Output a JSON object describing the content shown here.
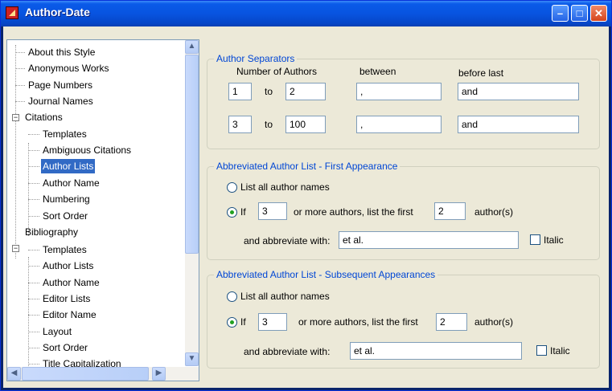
{
  "window": {
    "title": "Author-Date"
  },
  "tree": {
    "items": [
      {
        "label": "About this Style"
      },
      {
        "label": "Anonymous Works"
      },
      {
        "label": "Page Numbers"
      },
      {
        "label": "Journal Names"
      },
      {
        "label": "Citations",
        "expander": "−"
      },
      {
        "label": "Templates"
      },
      {
        "label": "Ambiguous Citations"
      },
      {
        "label": "Author Lists",
        "selected": true
      },
      {
        "label": "Author Name"
      },
      {
        "label": "Numbering"
      },
      {
        "label": "Sort Order"
      },
      {
        "label": "Bibliography",
        "expander": "−"
      },
      {
        "label": "Templates"
      },
      {
        "label": "Author Lists"
      },
      {
        "label": "Author Name"
      },
      {
        "label": "Editor Lists"
      },
      {
        "label": "Editor Name"
      },
      {
        "label": "Layout"
      },
      {
        "label": "Sort Order"
      },
      {
        "label": "Title Capitalization"
      }
    ]
  },
  "separators": {
    "legend": "Author Separators",
    "col_number": "Number of Authors",
    "col_between": "between",
    "col_before_last": "before last",
    "to_label": "to",
    "rows": [
      {
        "from": "1",
        "to": "2",
        "between": ",",
        "before_last": "and"
      },
      {
        "from": "3",
        "to": "100",
        "between": ",",
        "before_last": "and"
      }
    ]
  },
  "first": {
    "legend": "Abbreviated Author List - First Appearance",
    "list_all": "List all author names",
    "if_label": "If",
    "if_value": "3",
    "more_label": "or more authors, list the first",
    "first_value": "2",
    "authors_label": "author(s)",
    "abbrev_label": "and abbreviate with:",
    "abbrev_value": "et al.",
    "italic_label": "Italic"
  },
  "subsequent": {
    "legend": "Abbreviated Author List - Subsequent Appearances",
    "list_all": "List all author names",
    "if_label": "If",
    "if_value": "3",
    "more_label": "or more authors, list the first",
    "first_value": "2",
    "authors_label": "author(s)",
    "abbrev_label": "and abbreviate with:",
    "abbrev_value": "et al.",
    "italic_label": "Italic"
  },
  "icons": {
    "minimize": "–",
    "maximize": "□",
    "close": "✕",
    "up": "▲",
    "down": "▼",
    "left": "◀",
    "right": "▶"
  }
}
